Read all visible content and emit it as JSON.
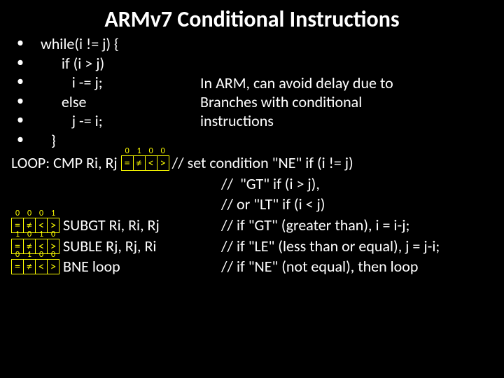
{
  "title": "ARMv7 Conditional Instructions",
  "bullets": [
    "while(i != j) {",
    "      if (i > j)",
    "         i -= j;",
    "      else",
    "         j -= i;",
    "   }"
  ],
  "side_note": [
    "In ARM, can avoid delay due to",
    "Branches with conditional",
    "instructions"
  ],
  "flag_symbols": [
    "=",
    "≠",
    "<",
    ">"
  ],
  "line_loop": {
    "label": "LOOP: CMP Ri, Rj ",
    "bits": [
      "0",
      "1",
      "0",
      "0"
    ],
    "comment1": "// set condition \"NE\" if (i != j)",
    "comment2": "//  \"GT\" if (i > j),",
    "comment3": "// or \"LT\" if (i < j)"
  },
  "line_subgt": {
    "bits": [
      "0",
      "0",
      "0",
      "1"
    ],
    "instr": " SUBGT Ri, Ri, Rj",
    "comment": "// if \"GT\" (greater than), i = i-j;"
  },
  "line_suble": {
    "bits": [
      "1",
      "0",
      "1",
      "0"
    ],
    "instr": " SUBLE Rj, Rj, Ri",
    "comment": "// if \"LE\" (less than or equal), j = j-i;"
  },
  "line_bne": {
    "bits": [
      "0",
      "1",
      "0",
      "0"
    ],
    "instr": " BNE loop",
    "comment": "// if \"NE\" (not equal), then loop"
  }
}
